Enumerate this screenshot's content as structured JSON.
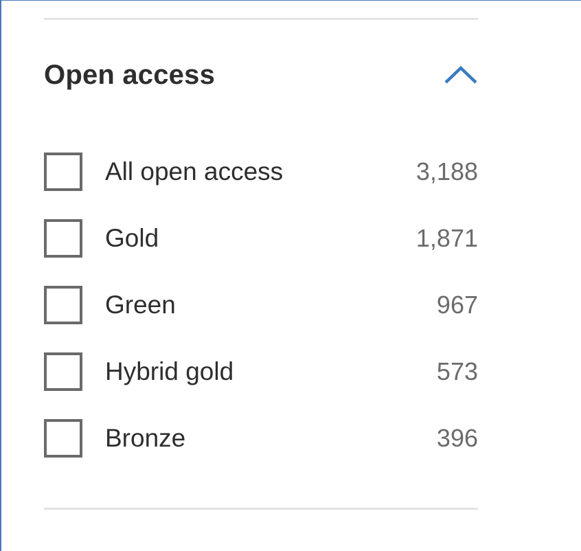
{
  "filter": {
    "title": "Open access",
    "toggle_icon": "chevron-up-icon",
    "accent_color": "#3a7bbf",
    "options": [
      {
        "label": "All open access",
        "count": "3,188",
        "checked": false
      },
      {
        "label": "Gold",
        "count": "1,871",
        "checked": false
      },
      {
        "label": "Green",
        "count": "967",
        "checked": false
      },
      {
        "label": "Hybrid gold",
        "count": "573",
        "checked": false
      },
      {
        "label": "Bronze",
        "count": "396",
        "checked": false
      }
    ]
  }
}
